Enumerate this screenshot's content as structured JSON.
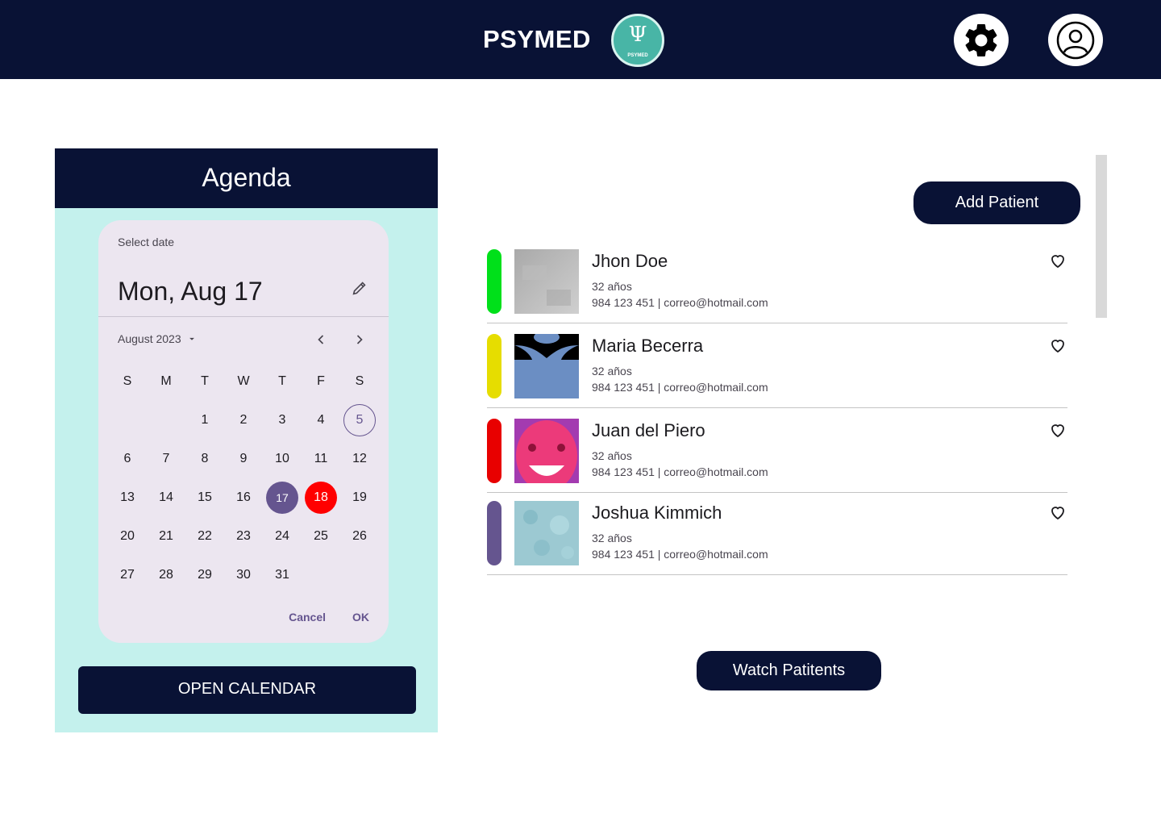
{
  "header": {
    "brand": "PSYMED",
    "logo_text": "PSYMED",
    "logo_symbol": "Ψ",
    "settings_icon": "gear-icon",
    "profile_icon": "user-icon"
  },
  "agenda": {
    "title": "Agenda",
    "picker": {
      "select_label": "Select date",
      "selected_date": "Mon, Aug 17",
      "month_label": "August 2023",
      "weekdays": [
        "S",
        "M",
        "T",
        "W",
        "T",
        "F",
        "S"
      ],
      "leading_blanks": 2,
      "days": [
        "1",
        "2",
        "3",
        "4",
        "5",
        "6",
        "7",
        "8",
        "9",
        "10",
        "11",
        "12",
        "13",
        "14",
        "15",
        "16",
        "17",
        "18",
        "19",
        "20",
        "21",
        "22",
        "23",
        "24",
        "25",
        "26",
        "27",
        "28",
        "29",
        "30",
        "31"
      ],
      "today": "5",
      "selected": "17",
      "marked": "18",
      "cancel_label": "Cancel",
      "ok_label": "OK"
    },
    "open_calendar_label": "OPEN CALENDAR"
  },
  "patients": {
    "add_label": "Add Patient",
    "watch_label": "Watch Patitents",
    "list": [
      {
        "name": "Jhon Doe",
        "age": "32 años",
        "contact": "984 123 451  |  correo@hotmail.com",
        "tag_color": "#00e01a"
      },
      {
        "name": "Maria Becerra",
        "age": "32 años",
        "contact": "984 123 451  |  correo@hotmail.com",
        "tag_color": "#e6dd00"
      },
      {
        "name": "Juan del Piero",
        "age": "32 años",
        "contact": "984 123 451  |  correo@hotmail.com",
        "tag_color": "#e80000"
      },
      {
        "name": "Joshua Kimmich",
        "age": "32 años",
        "contact": "984 123 451  |  correo@hotmail.com",
        "tag_color": "#65558f"
      }
    ]
  },
  "colors": {
    "navy": "#091235",
    "agenda_bg": "#c4f1ed",
    "picker_bg": "#ece6f0",
    "accent": "#65558f",
    "marked": "#ff0000"
  }
}
